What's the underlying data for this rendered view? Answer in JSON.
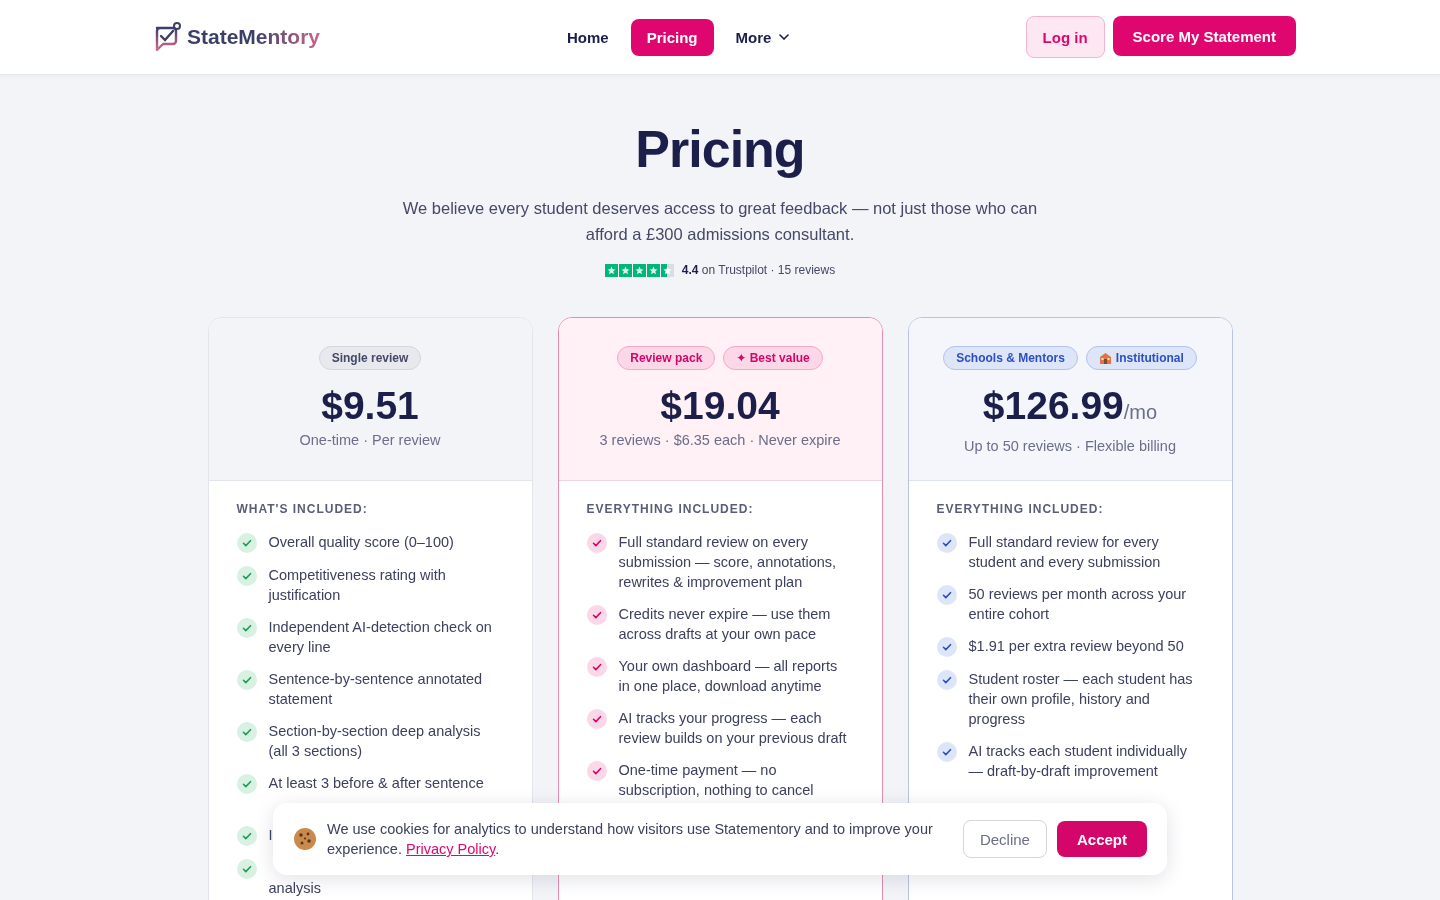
{
  "nav": {
    "brand": "StateMentory",
    "links": [
      {
        "label": "Home",
        "selected": false,
        "dropdown": false
      },
      {
        "label": "Pricing",
        "selected": true,
        "dropdown": false
      },
      {
        "label": "More",
        "selected": false,
        "dropdown": true
      }
    ],
    "login": "Log in",
    "cta": "Score My Statement"
  },
  "hero": {
    "title": "Pricing",
    "subtitle": "We believe every student deserves access to great feedback — not just those who can afford a £300 admissions consultant.",
    "rating": {
      "stars": 4.5,
      "score": "4.4",
      "text": "on Trustpilot · 15 reviews"
    }
  },
  "plans": [
    {
      "kind": "neutral",
      "badges": [
        {
          "text": "Single review",
          "icon": false
        }
      ],
      "price": "$9.51",
      "note": "One-time · Per review",
      "features_heading": "WHAT'S INCLUDED:",
      "features": [
        {
          "lines": [
            "Overall quality score (0–100)"
          ]
        },
        {
          "lines": [
            "Competitiveness rating with",
            "justification"
          ]
        },
        {
          "lines": [
            "Independent AI-detection check on",
            "every line"
          ]
        },
        {
          "lines": [
            "Sentence-by-sentence annotated",
            "statement"
          ]
        },
        {
          "lines": [
            "Section-by-section deep analysis",
            "(all 3 sections)"
          ]
        },
        {
          "lines": [
            "At least 3 before & after sentence"
          ],
          "last_line_hidden": true
        },
        {
          "lines": [
            "I"
          ]
        },
        {
          "lines": [
            "analysis"
          ],
          "first_line_hidden": true
        }
      ]
    },
    {
      "kind": "featured",
      "badges": [
        {
          "text": "Review pack",
          "icon": false
        },
        {
          "text": "✦ Best value",
          "icon": false
        }
      ],
      "price": "$19.04",
      "note": "3 reviews · $6.35 each · Never expire",
      "features_heading": "EVERYTHING INCLUDED:",
      "features": [
        {
          "lines": [
            "Full standard review on every",
            "submission — score, annotations,",
            "rewrites & improvement plan"
          ]
        },
        {
          "lines": [
            "Credits never expire — use them",
            "across drafts at your own pace"
          ]
        },
        {
          "lines": [
            "Your own dashboard — all reports",
            "in one place, download anytime"
          ]
        },
        {
          "lines": [
            "AI tracks your progress — each",
            "review builds on your previous draft"
          ]
        },
        {
          "lines": [
            "One-time payment — no",
            "subscription, nothing to cancel"
          ]
        }
      ]
    },
    {
      "kind": "institutional",
      "badges": [
        {
          "text": "Schools & Mentors",
          "icon": false
        },
        {
          "text": "Institutional",
          "icon": true
        }
      ],
      "price": "$126.99",
      "period": "/mo",
      "note": "Up to 50 reviews · Flexible billing",
      "features_heading": "EVERYTHING INCLUDED:",
      "features": [
        {
          "lines": [
            "Full standard review for every",
            "student and every submission"
          ]
        },
        {
          "lines": [
            "50 reviews per month across your",
            "entire cohort"
          ]
        },
        {
          "lines": [
            "$1.91 per extra review beyond 50"
          ]
        },
        {
          "lines": [
            "Student roster — each student has",
            "their own profile, history and",
            "progress"
          ]
        },
        {
          "lines": [
            "AI tracks each student individually",
            "— draft-by-draft improvement"
          ]
        }
      ]
    }
  ],
  "cookie_banner": {
    "text": "We use cookies for analytics to understand how visitors use Statementory and to improve your experience.",
    "link": "Privacy Policy",
    "end": ".",
    "decline": "Decline",
    "accept": "Accept"
  }
}
